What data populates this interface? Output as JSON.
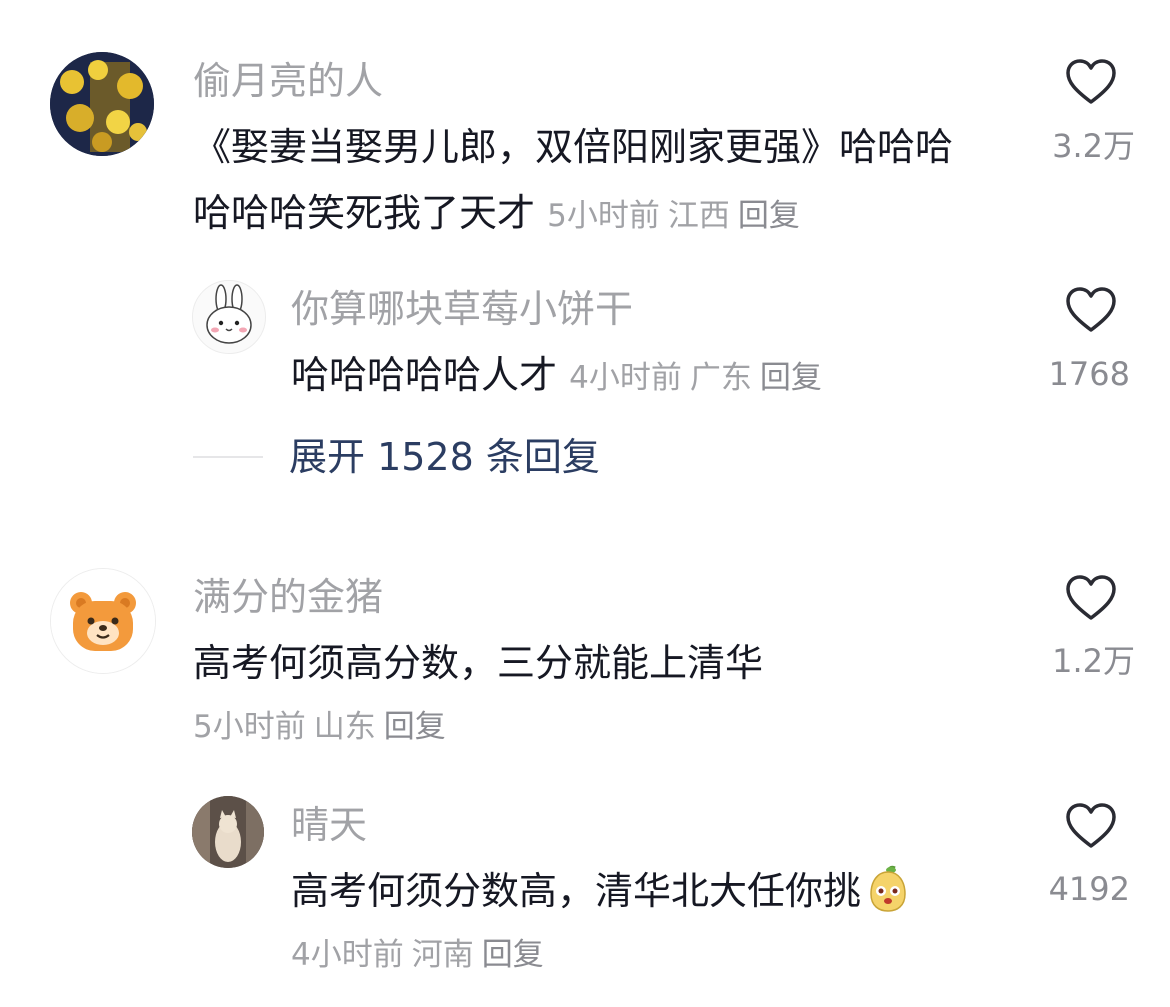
{
  "comments": [
    {
      "username": "偷月亮的人",
      "text_line1": "《娶妻当娶男儿郎，双倍阳刚家更强》哈哈哈",
      "text_line2": "哈哈哈笑死我了天才",
      "time": "5小时前",
      "location": "江西",
      "reply_label": "回复",
      "likes": "3.2万",
      "avatar_icon": "yellow-flowers-avatar",
      "replies": [
        {
          "username": "你算哪块草莓小饼干",
          "text": "哈哈哈哈哈人才",
          "time": "4小时前",
          "location": "广东",
          "reply_label": "回复",
          "likes": "1768",
          "avatar_icon": "white-rabbit-avatar"
        }
      ],
      "expand_label": "展开 1528 条回复"
    },
    {
      "username": "满分的金猪",
      "text": "高考何须高分数，三分就能上清华",
      "time": "5小时前",
      "location": "山东",
      "reply_label": "回复",
      "likes": "1.2万",
      "avatar_icon": "orange-bear-avatar",
      "replies": [
        {
          "username": "晴天",
          "text": "高考何须分数高，清华北大任你挑",
          "time": "4小时前",
          "location": "河南",
          "reply_label": "回复",
          "likes": "4192",
          "avatar_icon": "cat-photo-avatar",
          "emoji": "pear-face-emoji"
        }
      ]
    }
  ],
  "colors": {
    "text": "#161823",
    "muted": "#a1a2a6",
    "expand": "#2b3d62",
    "bear": "#f39a3c"
  }
}
